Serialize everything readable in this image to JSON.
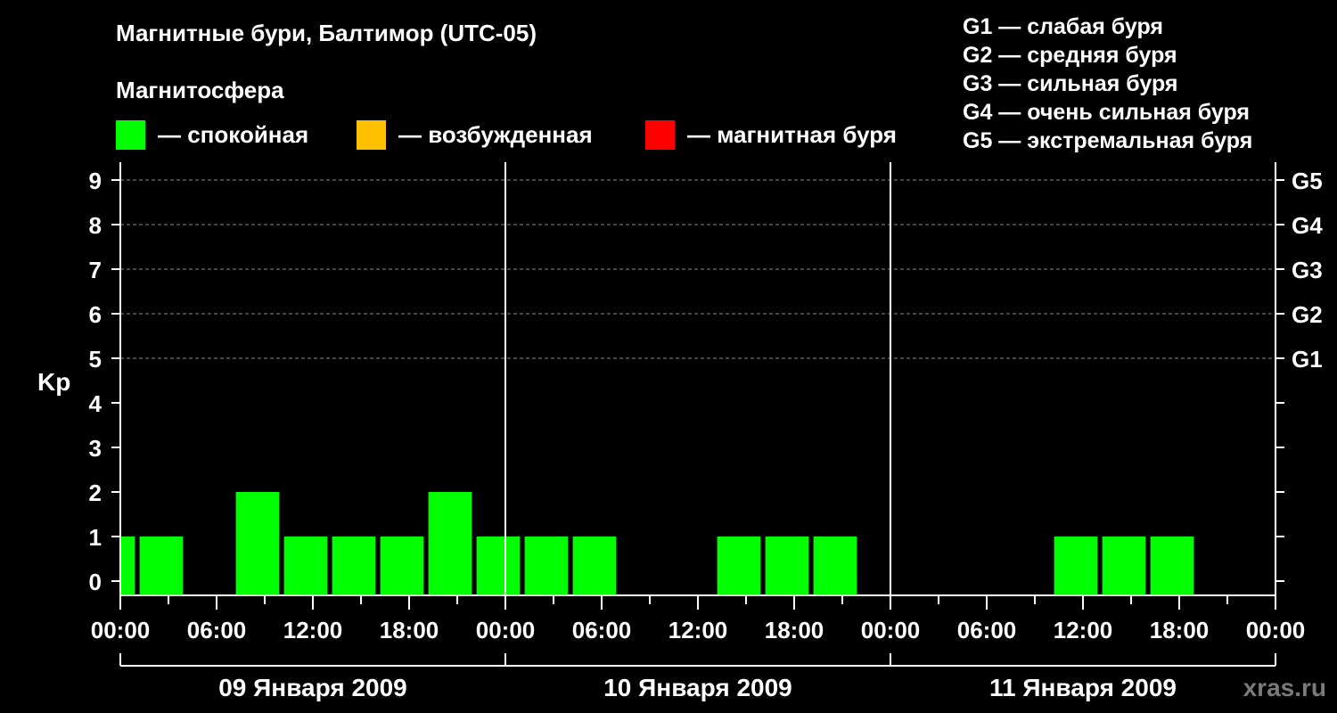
{
  "header": {
    "title": "Магнитные бури, Балтимор (UTC-05)",
    "subtitle": "Магнитосфера"
  },
  "legend": [
    {
      "label": "— спокойная",
      "color": "#00ff00"
    },
    {
      "label": "— возбужденная",
      "color": "#ffc000"
    },
    {
      "label": "— магнитная буря",
      "color": "#ff0000"
    }
  ],
  "storm_scale": [
    "G1 — слабая буря",
    "G2 — средняя буря",
    "G3 — сильная буря",
    "G4 — очень сильная буря",
    "G5 — экстремальная буря"
  ],
  "watermark": "xras.ru",
  "chart_data": {
    "type": "bar",
    "ylabel": "Kp",
    "ylim": [
      0,
      9
    ],
    "y_ticks": [
      "0",
      "1",
      "2",
      "3",
      "4",
      "5",
      "6",
      "7",
      "8",
      "9"
    ],
    "right_axis_labels": [
      {
        "kp": 5,
        "label": "G1"
      },
      {
        "kp": 6,
        "label": "G2"
      },
      {
        "kp": 7,
        "label": "G3"
      },
      {
        "kp": 8,
        "label": "G4"
      },
      {
        "kp": 9,
        "label": "G5"
      }
    ],
    "x_tick_labels": [
      "00:00",
      "06:00",
      "12:00",
      "18:00",
      "00:00",
      "06:00",
      "12:00",
      "18:00",
      "00:00",
      "06:00",
      "12:00",
      "18:00",
      "00:00"
    ],
    "days": [
      "09 Января 2009",
      "10 Января 2009",
      "11 Января 2009"
    ],
    "grid": "dashed horizontal at Kp 5–9; solid vertical at midnight",
    "bar_color": "#00ff00",
    "bars": [
      {
        "day": "09 Января 2009",
        "start_hour": 0,
        "end_hour": 0.9,
        "kp": 1
      },
      {
        "day": "09 Января 2009",
        "start_hour": 1.2,
        "end_hour": 3.9,
        "kp": 1
      },
      {
        "day": "09 Января 2009",
        "start_hour": 7.2,
        "end_hour": 9.9,
        "kp": 2
      },
      {
        "day": "09 Января 2009",
        "start_hour": 10.2,
        "end_hour": 12.9,
        "kp": 1
      },
      {
        "day": "09 Января 2009",
        "start_hour": 13.2,
        "end_hour": 15.9,
        "kp": 1
      },
      {
        "day": "09 Января 2009",
        "start_hour": 16.2,
        "end_hour": 18.9,
        "kp": 1
      },
      {
        "day": "09 Января 2009",
        "start_hour": 19.2,
        "end_hour": 21.9,
        "kp": 2
      },
      {
        "day": "09 Января 2009",
        "start_hour": 22.2,
        "end_hour": 24.9,
        "kp": 1
      },
      {
        "day": "10 Января 2009",
        "start_hour": 1.2,
        "end_hour": 3.9,
        "kp": 1
      },
      {
        "day": "10 Января 2009",
        "start_hour": 4.2,
        "end_hour": 6.9,
        "kp": 1
      },
      {
        "day": "10 Января 2009",
        "start_hour": 13.2,
        "end_hour": 15.9,
        "kp": 1
      },
      {
        "day": "10 Января 2009",
        "start_hour": 16.2,
        "end_hour": 18.9,
        "kp": 1
      },
      {
        "day": "10 Января 2009",
        "start_hour": 19.2,
        "end_hour": 21.9,
        "kp": 1
      },
      {
        "day": "11 Января 2009",
        "start_hour": 10.2,
        "end_hour": 12.9,
        "kp": 1
      },
      {
        "day": "11 Января 2009",
        "start_hour": 13.2,
        "end_hour": 15.9,
        "kp": 1
      },
      {
        "day": "11 Января 2009",
        "start_hour": 16.2,
        "end_hour": 18.9,
        "kp": 1
      }
    ]
  }
}
